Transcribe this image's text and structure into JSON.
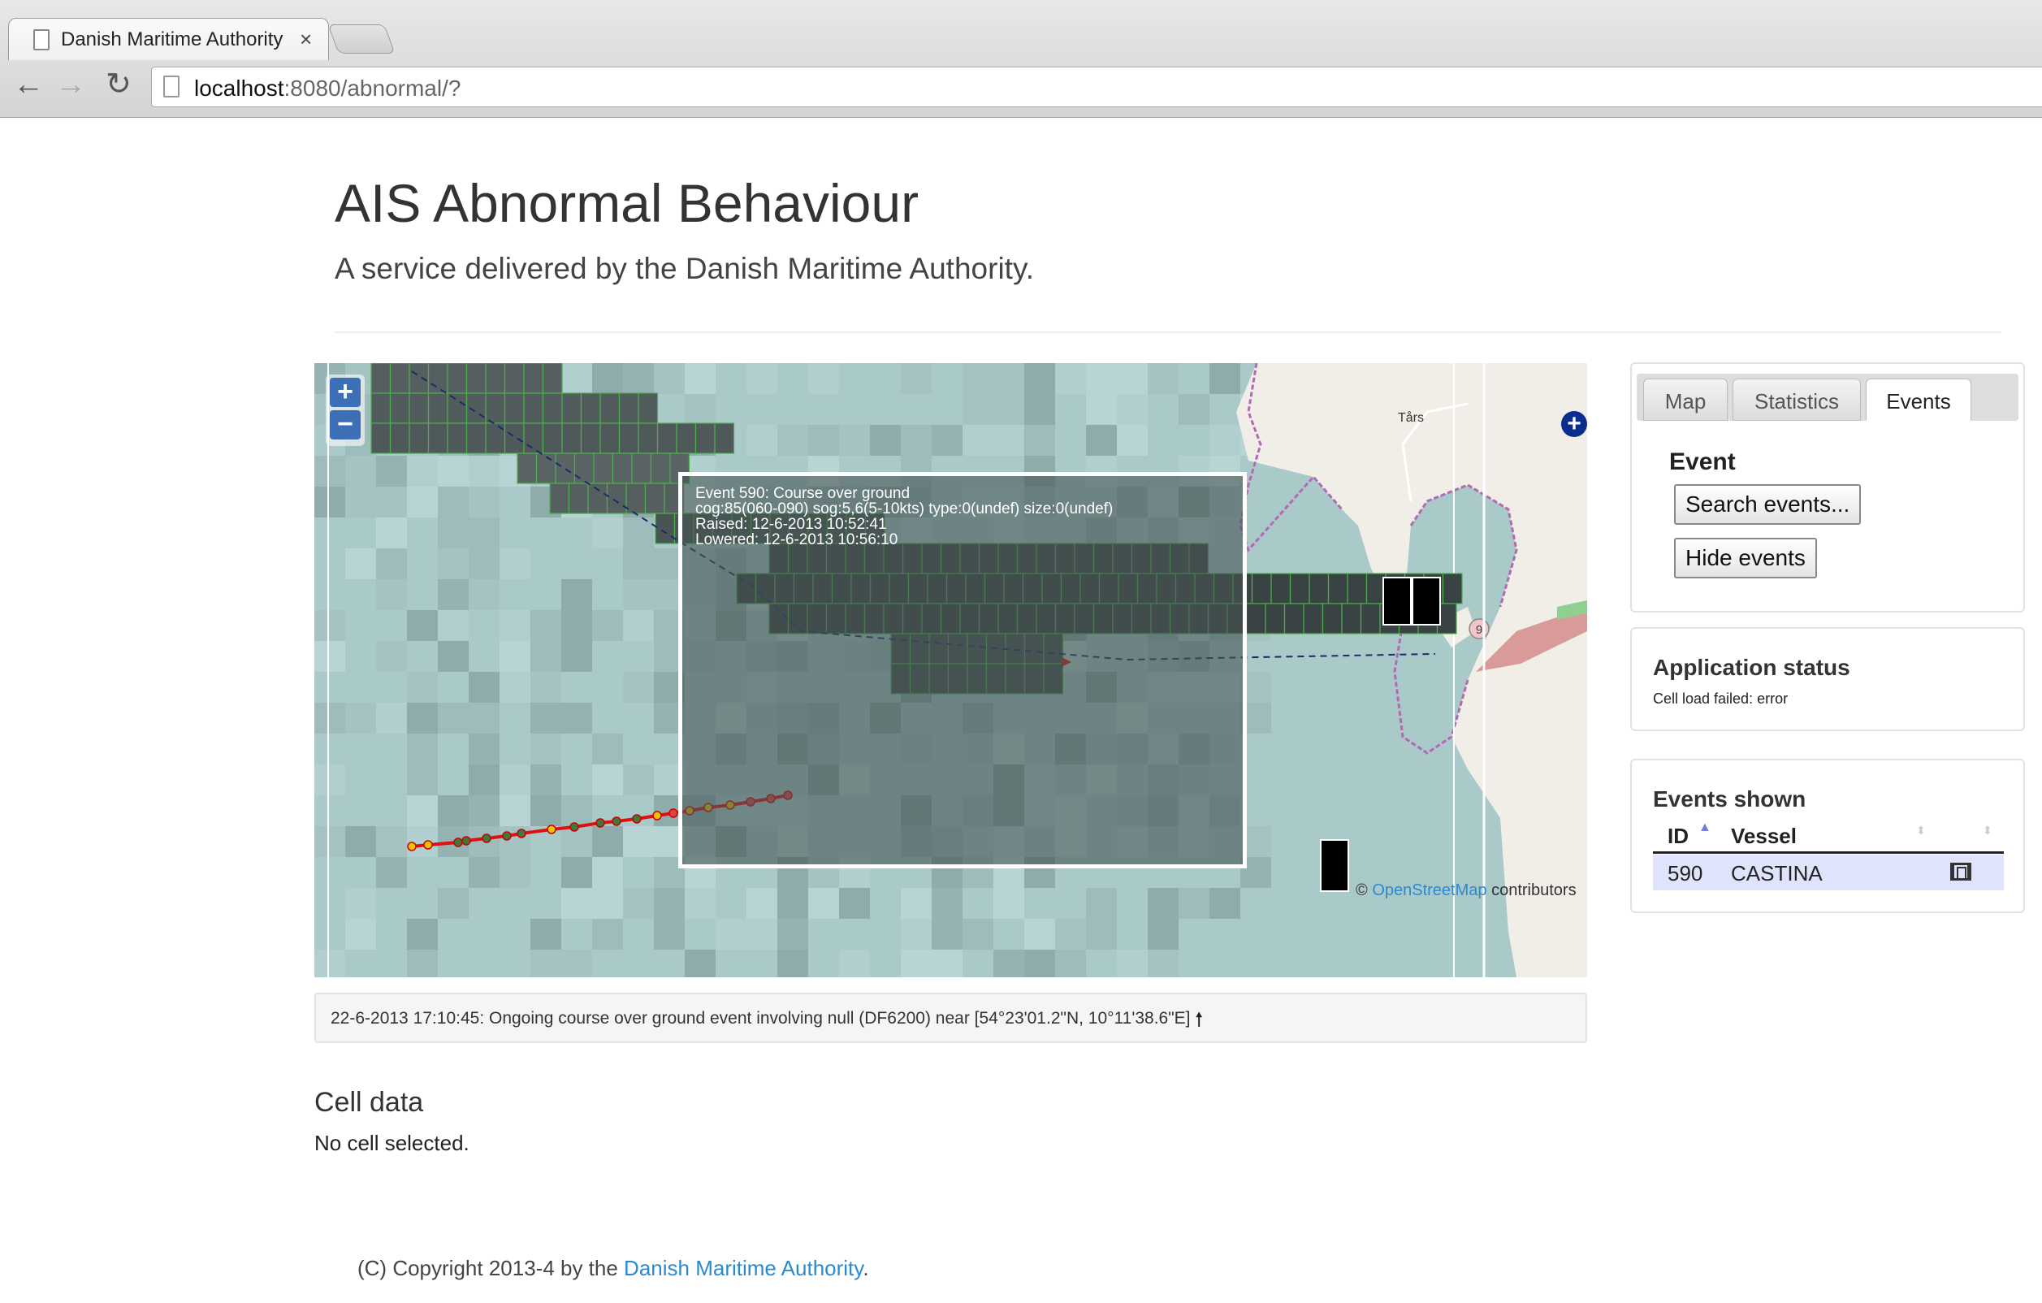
{
  "browser": {
    "tab_title": "Danish Maritime Authority",
    "tab_close": "×",
    "url_host": "localhost",
    "url_rest": ":8080/abnormal/?",
    "back_glyph": "←",
    "forward_glyph": "→",
    "reload_glyph": "↻"
  },
  "header": {
    "title": "AIS Abnormal Behaviour",
    "subtitle": "A service delivered by the Danish Maritime Authority."
  },
  "map": {
    "zoom_in": "+",
    "zoom_out": "−",
    "layer_switcher": "+",
    "place_label": "Tårs",
    "road_number": "9",
    "popup": {
      "line1": "Event 590: Course over ground",
      "line2": "cog:85(060-090) sog:5,6(5-10kts) type:0(undef) size:0(undef)",
      "line3": "Raised: 12-6-2013 10:52:41",
      "line4": "Lowered: 12-6-2013 10:56:10"
    },
    "attribution_prefix": "©",
    "attribution_link": "OpenStreetMap",
    "attribution_suffix": " contributors",
    "colors": {
      "sea": "#aac9c9",
      "land": "#f1eee8",
      "track": "#e01010",
      "grid": "#4cae4c"
    }
  },
  "status_bar": {
    "text": "22-6-2013 17:10:45: Ongoing course over ground event involving null (DF6200) near [54°23'01.2\"N, 10°11'38.6\"E]",
    "arrow": "🠕"
  },
  "cell_data": {
    "title": "Cell data",
    "empty_text": "No cell selected."
  },
  "sidebar": {
    "tabs": [
      {
        "label": "Map"
      },
      {
        "label": "Statistics"
      },
      {
        "label": "Events"
      }
    ],
    "event_heading": "Event",
    "search_button": "Search events...",
    "hide_button": "Hide events",
    "app_status_title": "Application status",
    "app_status_text": "Cell load failed: error",
    "events_shown_title": "Events shown",
    "table": {
      "headers": [
        "ID",
        "Vessel"
      ],
      "sort_indicator": "▲",
      "sort_neutral": "⬍",
      "rows": [
        {
          "id": "590",
          "vessel": "CASTINA",
          "icon": "film-icon"
        }
      ]
    }
  },
  "footer": {
    "prefix": "(C) Copyright 2013-4 by the ",
    "link": "Danish Maritime Authority",
    "suffix": "."
  }
}
